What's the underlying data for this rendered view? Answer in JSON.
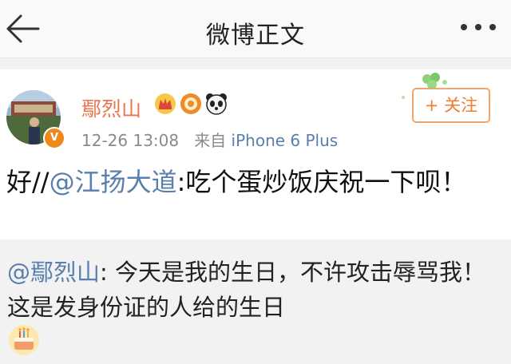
{
  "header": {
    "title": "微博正文",
    "back_icon": "back-arrow-icon",
    "more_icon": "more-dots-icon"
  },
  "post": {
    "author": {
      "name": "鄢烈山",
      "avatar": "avatar-photo",
      "verified_badge": "V",
      "badges": [
        "crown-badge-icon",
        "sun-medal-badge-icon",
        "panda-badge-icon"
      ]
    },
    "time": "12-26 13:08",
    "source_prefix": "来自",
    "source": "iPhone 6 Plus",
    "follow_label": "+ 关注",
    "text_prefix": "好//",
    "mention": "@江扬大道",
    "text_body": ":吃个蛋炒饭庆祝一下呗！"
  },
  "repost": {
    "mention": "@鄢烈山",
    "text": ": 今天是我的生日，不许攻击辱骂我！这是发身份证的人给的生日",
    "emoji": "birthday-cake-emoji"
  },
  "colors": {
    "accent_orange": "#eb7350",
    "link_blue": "#5a7ead",
    "follow_border": "#f0a56a"
  }
}
